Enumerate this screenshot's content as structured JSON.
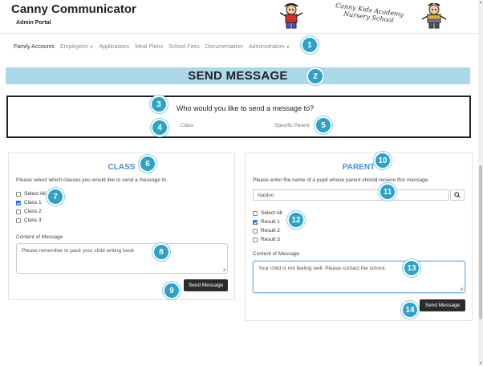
{
  "app": {
    "title": "Canny Communicator",
    "subtitle": "Admin Portal"
  },
  "logos": {
    "center_line1": "Canny Kids Academy",
    "center_line2": "Nursery School"
  },
  "nav": {
    "items": [
      {
        "label": "Family Accounts",
        "active": true,
        "dropdown": false
      },
      {
        "label": "Employees",
        "active": false,
        "dropdown": true
      },
      {
        "label": "Applications",
        "active": false,
        "dropdown": false
      },
      {
        "label": "Meal Plans",
        "active": false,
        "dropdown": false
      },
      {
        "label": "School Fees",
        "active": false,
        "dropdown": false
      },
      {
        "label": "Documentation",
        "active": false,
        "dropdown": false
      },
      {
        "label": "Administration",
        "active": false,
        "dropdown": true
      }
    ]
  },
  "page": {
    "title": "SEND MESSAGE"
  },
  "recipient": {
    "question": "Who would you like to send a message to?",
    "option_class": "Class",
    "option_parent": "Specific Parent"
  },
  "class_card": {
    "title": "CLASS",
    "instruction": "Please select which classes you would like to send a message to.",
    "options": [
      {
        "label": "Select All",
        "checked": false
      },
      {
        "label": "Class 1",
        "checked": true
      },
      {
        "label": "Class 2",
        "checked": false
      },
      {
        "label": "Class 3",
        "checked": false
      }
    ],
    "content_label": "Content of Message",
    "message": "Please remember to pack your child writing book",
    "send_label": "Send Message"
  },
  "parent_card": {
    "title": "PARENT",
    "instruction": "Please enter the name of a pupil whose parent should recieve this message.",
    "search_value": "Naidoo",
    "results": [
      {
        "label": "Select All",
        "checked": false
      },
      {
        "label": "Result 1",
        "checked": true
      },
      {
        "label": "Result 2",
        "checked": false
      },
      {
        "label": "Result 3",
        "checked": false
      }
    ],
    "content_label": "Content of Message",
    "message": "Your child is not feeling well. Please contact the school.",
    "send_label": "Send Message"
  },
  "badges": [
    "1",
    "2",
    "3",
    "4",
    "5",
    "6",
    "7",
    "8",
    "9",
    "10",
    "11",
    "12",
    "13",
    "14"
  ],
  "colors": {
    "accent": "#2ea2c6",
    "banner": "#add8ea",
    "card_title": "#4a8fd6",
    "button": "#2b2b2b"
  }
}
